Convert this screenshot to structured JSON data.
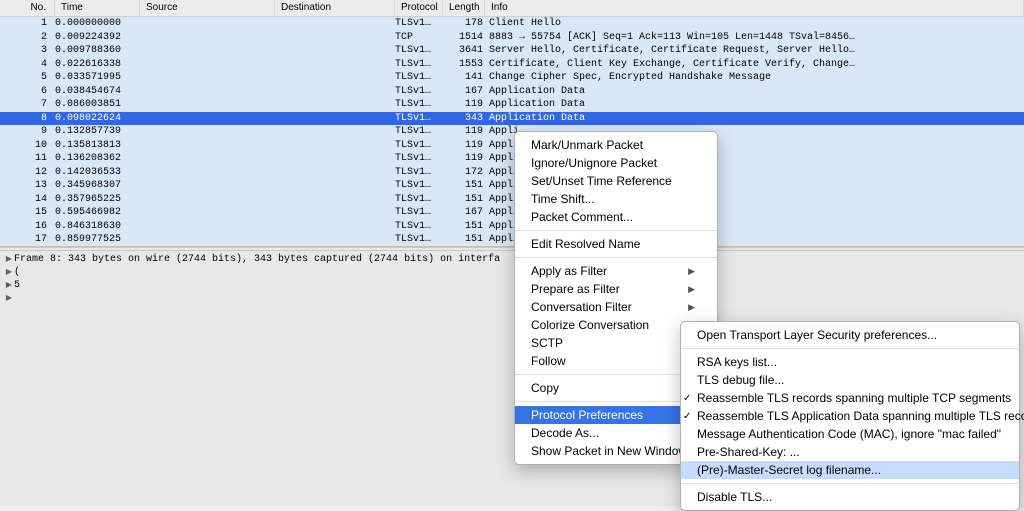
{
  "columns": {
    "no": "No.",
    "time": "Time",
    "source": "Source",
    "destination": "Destination",
    "protocol": "Protocol",
    "length": "Length",
    "info": "Info"
  },
  "packets": [
    {
      "no": "1",
      "time": "0.000000000",
      "proto": "TLSv1…",
      "len": "178",
      "info": "Client Hello"
    },
    {
      "no": "2",
      "time": "0.009224392",
      "proto": "TCP",
      "len": "1514",
      "info": "8883 → 55754 [ACK] Seq=1 Ack=113 Win=105 Len=1448 TSval=8456…"
    },
    {
      "no": "3",
      "time": "0.009788360",
      "proto": "TLSv1…",
      "len": "3641",
      "info": "Server Hello, Certificate, Certificate Request, Server Hello…"
    },
    {
      "no": "4",
      "time": "0.022616338",
      "proto": "TLSv1…",
      "len": "1553",
      "info": "Certificate, Client Key Exchange, Certificate Verify, Change…"
    },
    {
      "no": "5",
      "time": "0.033571995",
      "proto": "TLSv1…",
      "len": "141",
      "info": "Change Cipher Spec, Encrypted Handshake Message"
    },
    {
      "no": "6",
      "time": "0.038454674",
      "proto": "TLSv1…",
      "len": "167",
      "info": "Application Data"
    },
    {
      "no": "7",
      "time": "0.086003851",
      "proto": "TLSv1…",
      "len": "119",
      "info": "Application Data"
    },
    {
      "no": "8",
      "time": "0.098022624",
      "proto": "TLSv1…",
      "len": "343",
      "info": "Application Data",
      "selected": true
    },
    {
      "no": "9",
      "time": "0.132857739",
      "proto": "TLSv1…",
      "len": "119",
      "info": "Appli"
    },
    {
      "no": "10",
      "time": "0.135813813",
      "proto": "TLSv1…",
      "len": "119",
      "info": "Appli"
    },
    {
      "no": "11",
      "time": "0.136208362",
      "proto": "TLSv1…",
      "len": "119",
      "info": "Appli"
    },
    {
      "no": "12",
      "time": "0.142036533",
      "proto": "TLSv1…",
      "len": "172",
      "info": "Appli                            ta"
    },
    {
      "no": "13",
      "time": "0.345968307",
      "proto": "TLSv1…",
      "len": "151",
      "info": "Appli"
    },
    {
      "no": "14",
      "time": "0.357965225",
      "proto": "TLSv1…",
      "len": "151",
      "info": "Appli"
    },
    {
      "no": "15",
      "time": "0.595466982",
      "proto": "TLSv1…",
      "len": "167",
      "info": "Appli"
    },
    {
      "no": "16",
      "time": "0.846318630",
      "proto": "TLSv1…",
      "len": "151",
      "info": "Appli"
    },
    {
      "no": "17",
      "time": "0.859977525",
      "proto": "TLSv1…",
      "len": "151",
      "info": "Appli"
    }
  ],
  "detail_lines": [
    "Frame 8: 343 bytes on wire (2744 bits), 343 bytes captured (2744 bits) on interfa",
    "                                                            (",
    "                                                          5",
    ""
  ],
  "context_menu": {
    "mark": "Mark/Unmark Packet",
    "ignore": "Ignore/Unignore Packet",
    "timeref": "Set/Unset Time Reference",
    "timeshift": "Time Shift...",
    "comment": "Packet Comment...",
    "editname": "Edit Resolved Name",
    "applyfilter": "Apply as Filter",
    "preparefilter": "Prepare as Filter",
    "convfilter": "Conversation Filter",
    "colorize": "Colorize Conversation",
    "sctp": "SCTP",
    "follow": "Follow",
    "copy": "Copy",
    "protoprefs": "Protocol Preferences",
    "decode": "Decode As...",
    "showwin": "Show Packet in New Window"
  },
  "submenu": {
    "opentls": "Open Transport Layer Security preferences...",
    "rsakeys": "RSA keys list...",
    "tlsdebug": "TLS debug file...",
    "reassemble1": "Reassemble TLS records spanning multiple TCP segments",
    "reassemble2": "Reassemble TLS Application Data spanning multiple TLS records",
    "mac": "Message Authentication Code (MAC), ignore \"mac failed\"",
    "psk": "Pre-Shared-Key: ...",
    "premaster": "(Pre)-Master-Secret log filename...",
    "disable": "Disable TLS..."
  }
}
